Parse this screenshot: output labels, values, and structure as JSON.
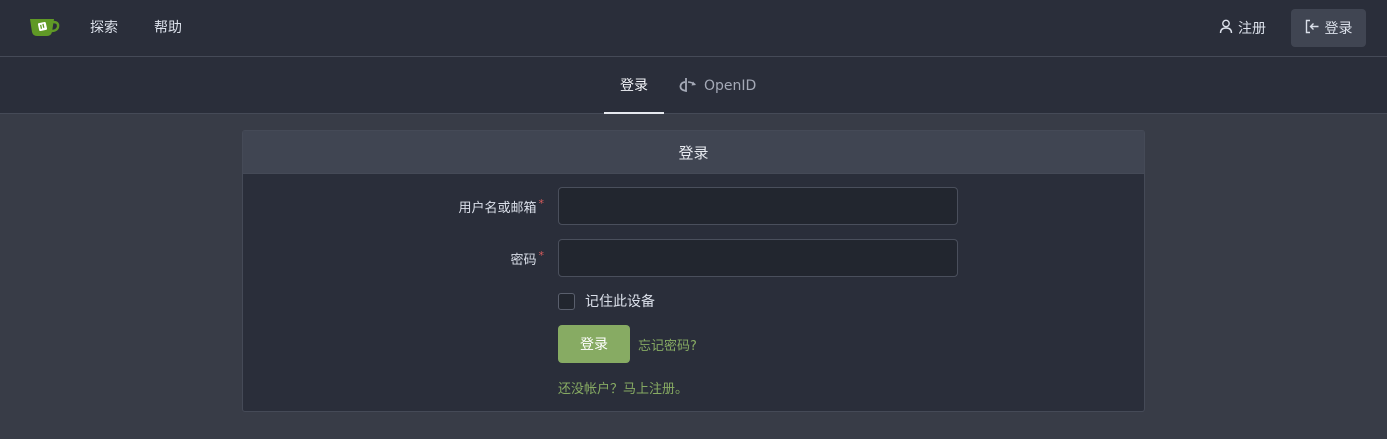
{
  "navbar": {
    "logo_icon": "gitea-teacup-logo",
    "explore_label": "探索",
    "help_label": "帮助",
    "register_label": "注册",
    "register_icon": "person-icon",
    "login_label": "登录",
    "login_icon": "sign-in-icon"
  },
  "tabs": {
    "login_label": "登录",
    "openid_label": "OpenID",
    "openid_icon": "openid-icon"
  },
  "card": {
    "header": "登录",
    "username_label": "用户名或邮箱",
    "username_value": "",
    "password_label": "密码",
    "password_value": "",
    "required_mark": "*",
    "remember_label": "记住此设备",
    "remember_checked": false,
    "submit_label": "登录",
    "forgot_label": "忘记密码?",
    "register_prompt": "还没帐户？马上注册。"
  },
  "colors": {
    "accent_green": "#87ab63",
    "background": "#383c47",
    "panel": "#2a2e3a",
    "required_red": "#d95c5c"
  }
}
